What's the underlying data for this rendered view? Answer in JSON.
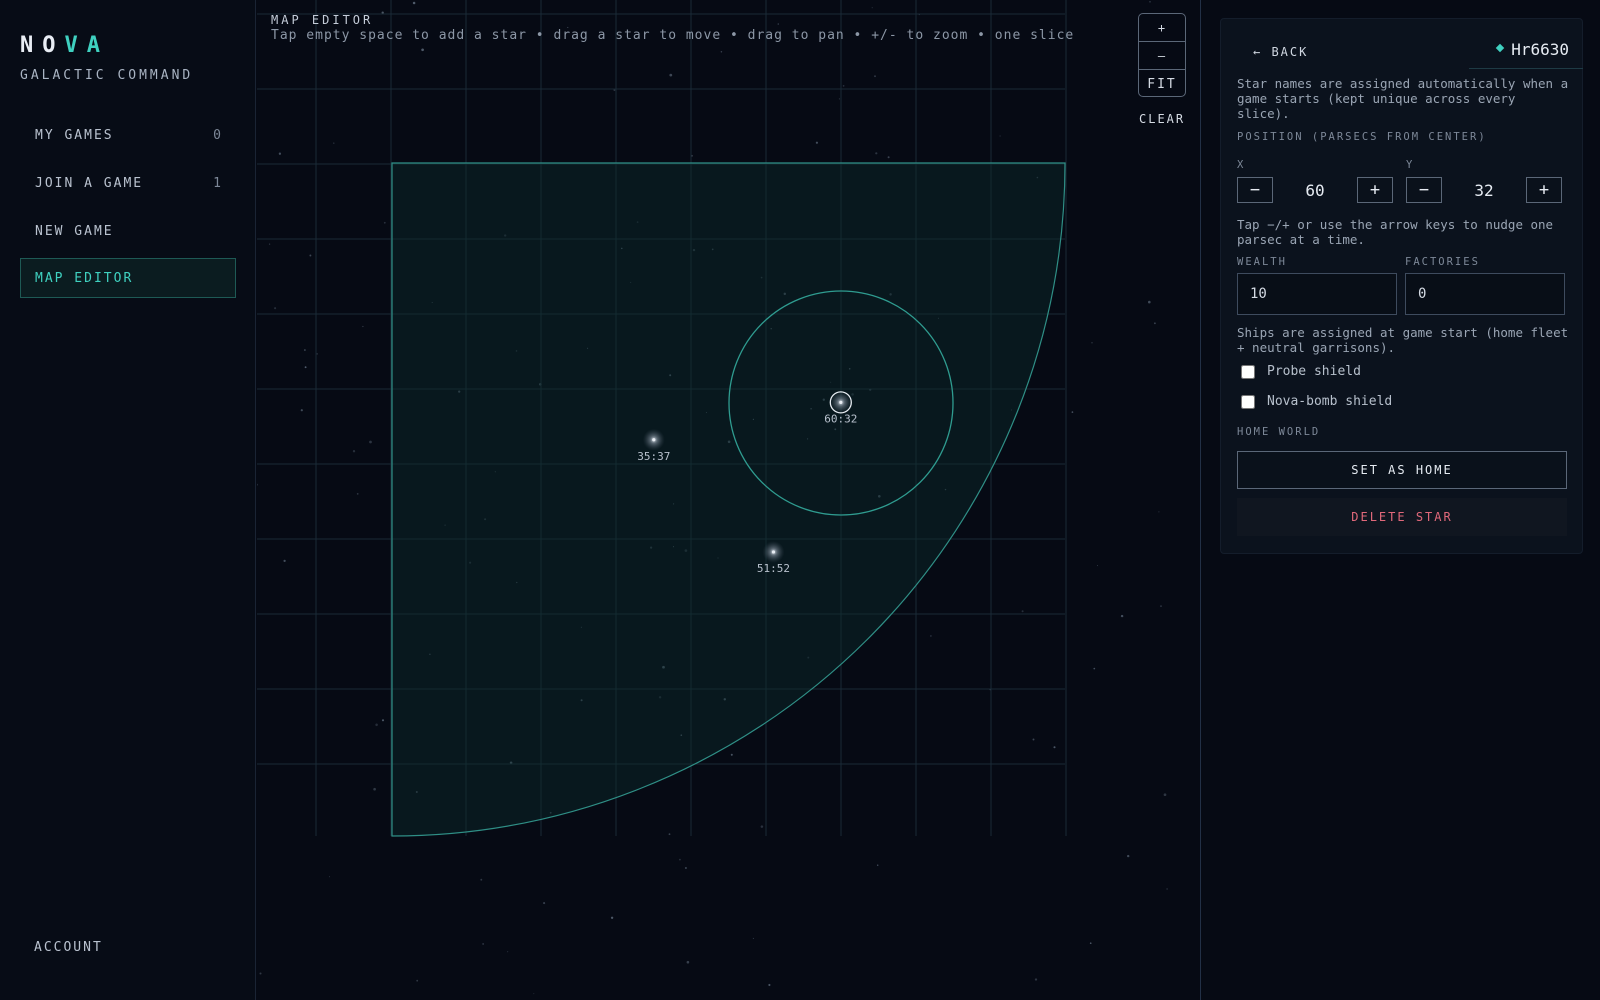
{
  "brand": {
    "letters": [
      "N",
      "O",
      "V",
      "A"
    ],
    "subtitle": "GALACTIC COMMAND"
  },
  "sidebar": {
    "items": [
      {
        "label": "MY GAMES",
        "count": "0"
      },
      {
        "label": "JOIN A GAME",
        "count": "1"
      },
      {
        "label": "NEW GAME",
        "count": ""
      },
      {
        "label": "MAP EDITOR",
        "count": "",
        "active": true
      }
    ],
    "account": "ACCOUNT"
  },
  "map": {
    "title": "MAP EDITOR",
    "hint": "Tap empty space to add a star • drag a star to move • drag to pan • +/- to zoom • one slice",
    "zoom_in": "+",
    "zoom_out": "–",
    "fit": "FIT",
    "clear": "CLEAR",
    "stars": [
      {
        "x": 60,
        "y": 32,
        "label": "60:32",
        "selected": true
      },
      {
        "x": 35,
        "y": 37,
        "label": "35:37"
      },
      {
        "x": 51,
        "y": 52,
        "label": "51:52"
      }
    ]
  },
  "panel": {
    "back": "← BACK",
    "star_name": "Hr6630",
    "name_note": "Star names are assigned automatically when a game starts (kept unique across every slice).",
    "position_label": "POSITION (PARSECS FROM CENTER)",
    "x_label": "X",
    "y_label": "Y",
    "x_value": "60",
    "y_value": "32",
    "minus": "−",
    "plus": "+",
    "nudge_note": "Tap −/+ or use the arrow keys to nudge one parsec at a time.",
    "wealth_label": "WEALTH",
    "wealth_value": "10",
    "factories_label": "FACTORIES",
    "factories_value": "0",
    "ships_note": "Ships are assigned at game start (home fleet + neutral garrisons).",
    "probe_shield": "Probe shield",
    "nova_shield": "Nova-bomb shield",
    "home_world_label": "HOME WORLD",
    "set_home": "SET AS HOME",
    "delete_star": "DELETE STAR"
  },
  "colors": {
    "accent": "#3fd1c0",
    "danger": "#e0687a",
    "background": "#060a14"
  }
}
